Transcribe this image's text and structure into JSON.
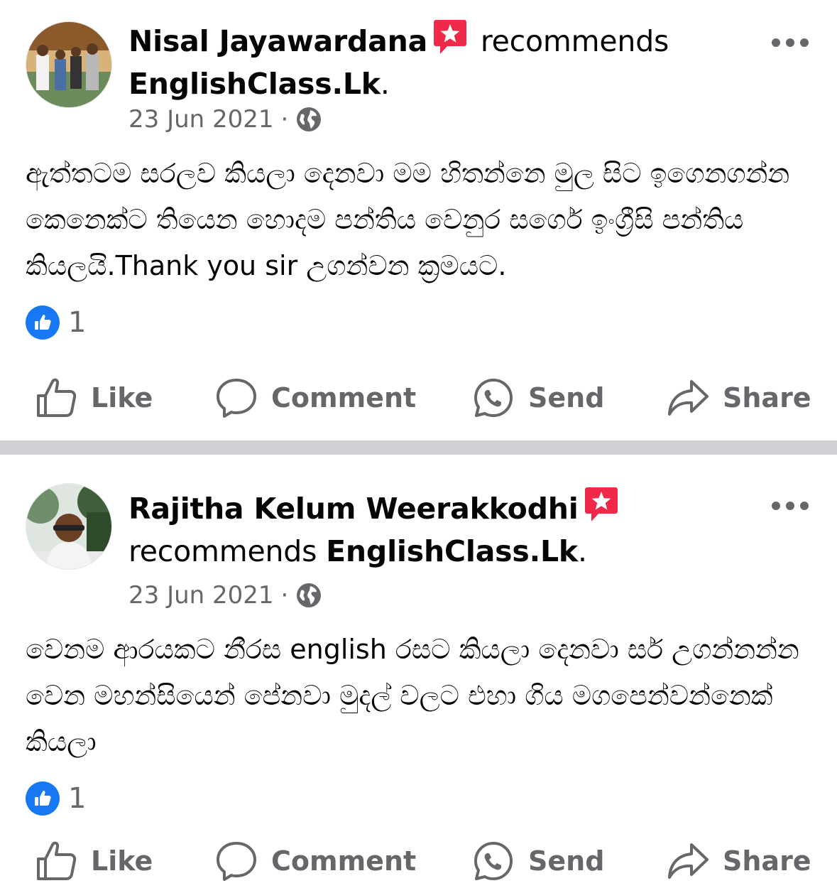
{
  "posts": [
    {
      "author": "Nisal Jayawardana",
      "recommends_word": "recommends",
      "page": "EnglishClass.Lk",
      "period": ".",
      "date": "23 Jun 2021",
      "separator": "·",
      "body": "ඇත්තටම සරලව කියලා දෙනවා මම හිතන්නෙ මුල සිට ඉගෙනගන්න කෙනෙක්ට තියෙන හොදම පන්තිය වෙනුර සර්ගෙ ඉංග්‍රීසි පන්තිය කියලයි.Thank you sir උගන්වන ක්‍රමයට.",
      "like_count": "1",
      "actions": {
        "like": "Like",
        "comment": "Comment",
        "send": "Send",
        "share": "Share"
      }
    },
    {
      "author": "Rajitha Kelum Weerakkodhi",
      "recommends_word": "recommends",
      "page": "EnglishClass.Lk",
      "period": ".",
      "date": "23 Jun 2021",
      "separator": "·",
      "body": "වෙනම ආරයකට නීරස english රසට කියලා දෙනවා සර් උගන්නන්න වෙන මහන්සියෙන් පේනවා මුදල් වලට එහා ගිය මගපෙන්වන්නෙක් කියලා",
      "like_count": "1",
      "actions": {
        "like": "Like",
        "comment": "Comment",
        "send": "Send",
        "share": "Share"
      }
    }
  ],
  "icons": {
    "recommend_badge": "recommendation-star-icon",
    "audience": "globe-icon",
    "more": "more-options-icon",
    "reaction": "thumbs-up-icon",
    "like": "thumbs-up-outline-icon",
    "comment": "comment-bubble-icon",
    "send": "messenger-icon",
    "share": "share-arrow-icon"
  },
  "colors": {
    "brand_blue": "#1877f2",
    "badge_red": "#f02849",
    "secondary_text": "#65676b",
    "divider": "#ced0d4"
  }
}
